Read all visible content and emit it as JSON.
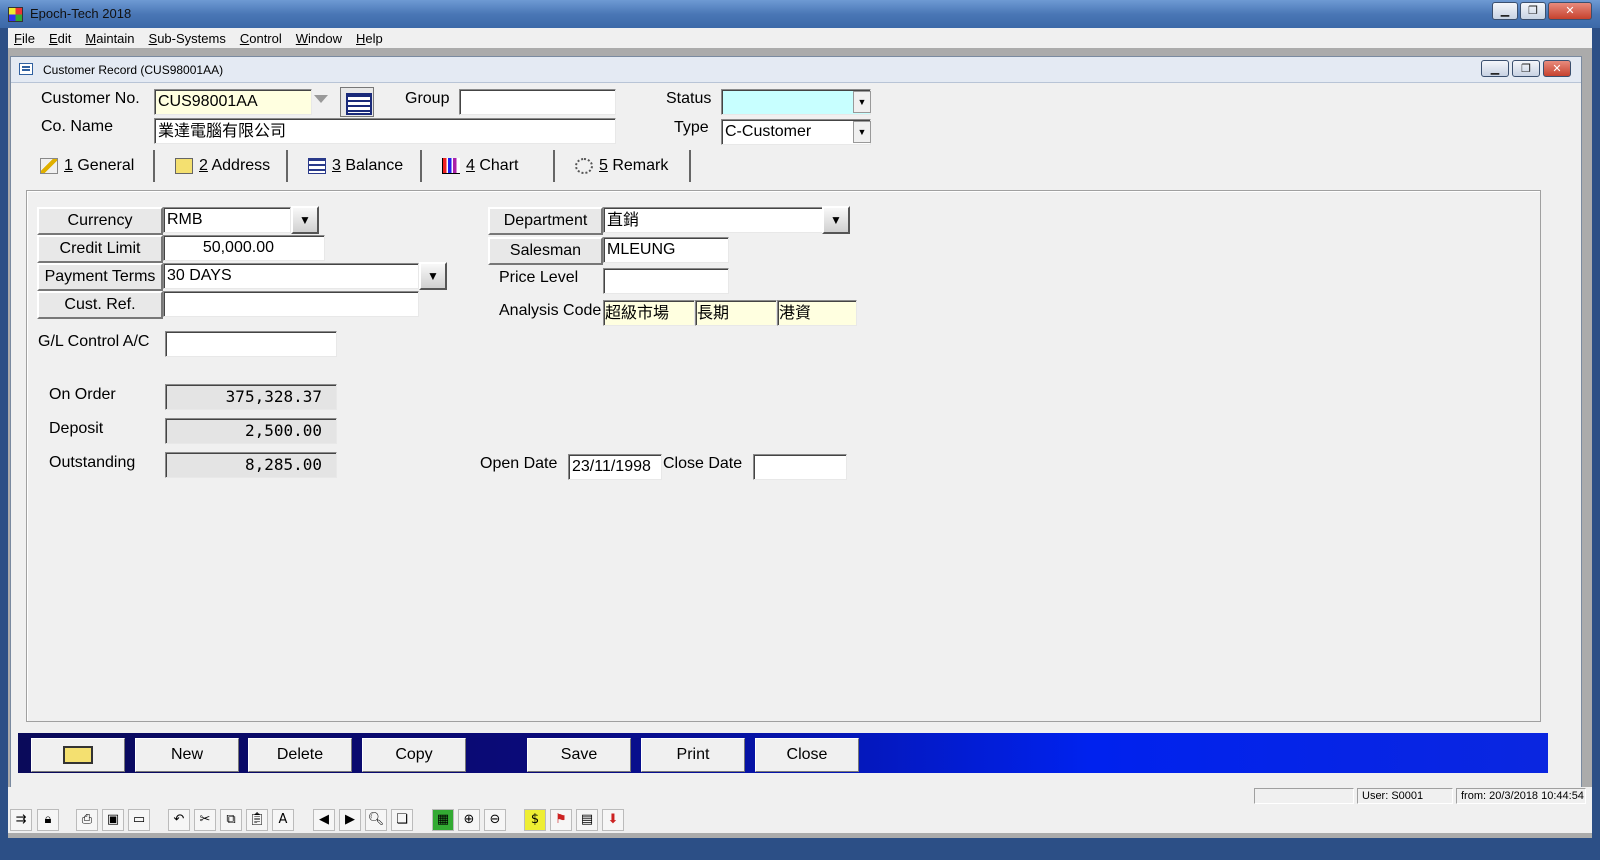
{
  "app": {
    "title": "Epoch-Tech 2018",
    "menu": [
      "File",
      "Edit",
      "Maintain",
      "Sub-Systems",
      "Control",
      "Window",
      "Help"
    ]
  },
  "child": {
    "title": "Customer Record (CUS98001AA)"
  },
  "header": {
    "customer_no_label": "Customer No.",
    "customer_no": "CUS98001AA",
    "group_label": "Group",
    "group": "",
    "status_label": "Status",
    "status": "",
    "co_name_label": "Co. Name",
    "co_name": "業達電腦有限公司",
    "type_label": "Type",
    "type": "C-Customer"
  },
  "tabs": [
    {
      "label": "1 General",
      "icon": "pencil-icon"
    },
    {
      "label": "2 Address",
      "icon": "envelope-icon"
    },
    {
      "label": "3 Balance",
      "icon": "ledger-icon"
    },
    {
      "label": "4 Chart",
      "icon": "bar-chart-icon"
    },
    {
      "label": "5 Remark",
      "icon": "gear-note-icon"
    }
  ],
  "general": {
    "currency_label": "Currency",
    "currency": "RMB",
    "credit_limit_label": "Credit Limit",
    "credit_limit": "50,000.00",
    "payment_terms_label": "Payment Terms",
    "payment_terms": "30 DAYS",
    "cust_ref_label": "Cust. Ref.",
    "cust_ref": "",
    "gl_control_label": "G/L Control A/C",
    "gl_control": "",
    "on_order_label": "On Order",
    "on_order": "375,328.37",
    "deposit_label": "Deposit",
    "deposit": "2,500.00",
    "outstanding_label": "Outstanding",
    "outstanding": "8,285.00",
    "department_label": "Department",
    "department": "直銷",
    "salesman_label": "Salesman",
    "salesman": "MLEUNG",
    "price_level_label": "Price Level",
    "price_level": "",
    "analysis_code_label": "Analysis Code",
    "analysis_codes": [
      "超級市場",
      "長期",
      "港資"
    ],
    "open_date_label": "Open Date",
    "open_date": "23/11/1998",
    "close_date_label": "Close Date",
    "close_date": ""
  },
  "buttons": {
    "new": "New",
    "delete": "Delete",
    "copy": "Copy",
    "save": "Save",
    "print": "Print",
    "close": "Close"
  },
  "status_bar": {
    "user": "User: S0001",
    "from": "from: 20/3/2018 10:44:54"
  }
}
